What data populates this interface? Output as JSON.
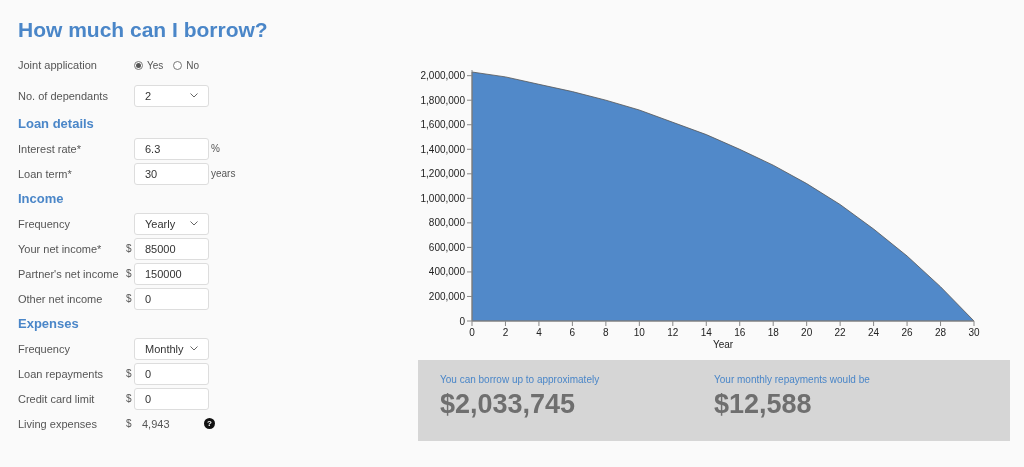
{
  "title": "How much can I borrow?",
  "form": [
    {
      "kind": "radio",
      "label": "Joint application",
      "options": [
        {
          "label": "Yes",
          "selected": true
        },
        {
          "label": "No",
          "selected": false
        }
      ]
    },
    {
      "kind": "select",
      "label": "No. of dependants",
      "value": "2"
    },
    {
      "kind": "heading",
      "label": "Loan details"
    },
    {
      "kind": "input",
      "label": "Interest rate*",
      "value": "6.3",
      "suffix": "%"
    },
    {
      "kind": "input",
      "label": "Loan term*",
      "value": "30",
      "suffix": "years"
    },
    {
      "kind": "heading",
      "label": "Income"
    },
    {
      "kind": "select",
      "label": "Frequency",
      "value": "Yearly"
    },
    {
      "kind": "input",
      "label": "Your net income*",
      "prefix": "$",
      "value": "85000"
    },
    {
      "kind": "input",
      "label": "Partner's net income",
      "prefix": "$",
      "value": "150000"
    },
    {
      "kind": "input",
      "label": "Other net income",
      "prefix": "$",
      "value": "0"
    },
    {
      "kind": "heading",
      "label": "Expenses"
    },
    {
      "kind": "select",
      "label": "Frequency",
      "value": "Monthly"
    },
    {
      "kind": "input",
      "label": "Loan repayments",
      "prefix": "$",
      "value": "0"
    },
    {
      "kind": "input",
      "label": "Credit card limit",
      "prefix": "$",
      "value": "0"
    },
    {
      "kind": "readout",
      "label": "Living expenses",
      "prefix": "$",
      "value": "4,943",
      "help": "?"
    }
  ],
  "chart_data": {
    "type": "area",
    "xlabel": "Year",
    "x": [
      0,
      2,
      4,
      6,
      8,
      10,
      12,
      14,
      16,
      18,
      20,
      22,
      24,
      26,
      28,
      30
    ],
    "series": [
      {
        "color": "#5189c9",
        "values": [
          2030000,
          1990000,
          1930000,
          1870000,
          1800000,
          1720000,
          1620000,
          1520000,
          1400000,
          1270000,
          1120000,
          950000,
          750000,
          530000,
          280000,
          0
        ]
      }
    ],
    "xlim": [
      0,
      30
    ],
    "ylim": [
      0,
      2030000
    ],
    "xticks": [
      0,
      2,
      4,
      6,
      8,
      10,
      12,
      14,
      16,
      18,
      20,
      22,
      24,
      26,
      28,
      30
    ],
    "yticks": [
      {
        "value": 0,
        "label": "0"
      },
      {
        "value": 200000,
        "label": "200,000"
      },
      {
        "value": 400000,
        "label": "400,000"
      },
      {
        "value": 600000,
        "label": "600,000"
      },
      {
        "value": 800000,
        "label": "800,000"
      },
      {
        "value": 1000000,
        "label": "1,000,000"
      },
      {
        "value": 1200000,
        "label": "1,200,000"
      },
      {
        "value": 1400000,
        "label": "1,400,000"
      },
      {
        "value": 1600000,
        "label": "1,600,000"
      },
      {
        "value": 1800000,
        "label": "1,800,000"
      },
      {
        "value": 2000000,
        "label": "2,000,000"
      }
    ]
  },
  "results": [
    {
      "label": "You can borrow up to approximately",
      "amount": "$2,033,745"
    },
    {
      "label": "Your monthly repayments would be",
      "amount": "$12,588"
    }
  ]
}
